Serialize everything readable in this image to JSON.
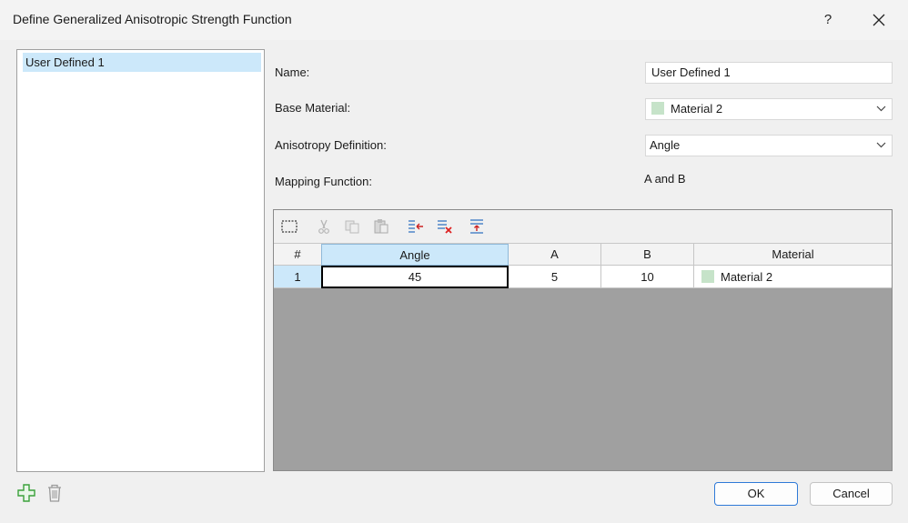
{
  "window": {
    "title": "Define Generalized Anisotropic Strength Function",
    "help_label": "?"
  },
  "functions_list": {
    "items": [
      {
        "label": "User Defined 1",
        "selected": true
      }
    ]
  },
  "form": {
    "name_label": "Name:",
    "name_value": "User Defined 1",
    "base_material_label": "Base Material:",
    "base_material_value": "Material 2",
    "base_material_swatch": "#c6e3c9",
    "anisotropy_label": "Anisotropy Definition:",
    "anisotropy_value": "Angle",
    "mapping_label": "Mapping Function:",
    "mapping_value": "A and B"
  },
  "grid": {
    "toolbar_icons": [
      "select-all-icon",
      "cut-icon",
      "copy-icon",
      "paste-icon",
      "insert-row-icon",
      "delete-row-icon",
      "append-row-icon"
    ],
    "columns": [
      "#",
      "Angle",
      "A",
      "B",
      "Material"
    ],
    "active_column": "Angle",
    "rows": [
      {
        "num": "1",
        "angle": "45",
        "a": "5",
        "b": "10",
        "material": "Material 2"
      }
    ]
  },
  "footer": {
    "add_icon": "plus-icon",
    "delete_icon": "trash-icon",
    "ok_label": "OK",
    "cancel_label": "Cancel"
  },
  "colors": {
    "selection": "#cce8fa",
    "grid_background": "#a0a0a0",
    "ok_border": "#2f7ad8",
    "add_icon": "#3aa13a"
  }
}
